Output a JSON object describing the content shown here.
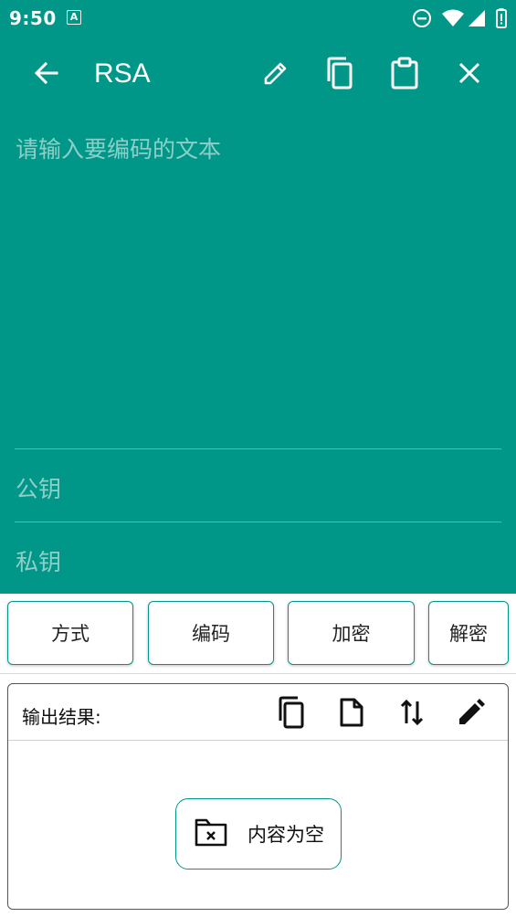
{
  "status_bar": {
    "time": "9:50",
    "badge": "A",
    "icons": [
      "dnd-icon",
      "wifi-icon",
      "signal-icon",
      "battery-icon"
    ]
  },
  "toolbar": {
    "title": "RSA",
    "icons": [
      "back-arrow-icon",
      "edit-pencil-icon",
      "copy-icon",
      "clipboard-icon",
      "close-icon"
    ]
  },
  "input": {
    "placeholder": "请输入要编码的文本",
    "public_key_placeholder": "公钥",
    "private_key_placeholder": "私钥"
  },
  "actions": {
    "method": "方式",
    "encoding": "编码",
    "encrypt": "加密",
    "decrypt": "解密"
  },
  "output": {
    "label": "输出结果:",
    "icons": [
      "copy-icon",
      "file-icon",
      "swap-vertical-icon",
      "edit-icon"
    ],
    "empty_text": "内容为空"
  },
  "colors": {
    "primary": "#009688",
    "on_primary": "#ffffff",
    "text": "#222222"
  }
}
